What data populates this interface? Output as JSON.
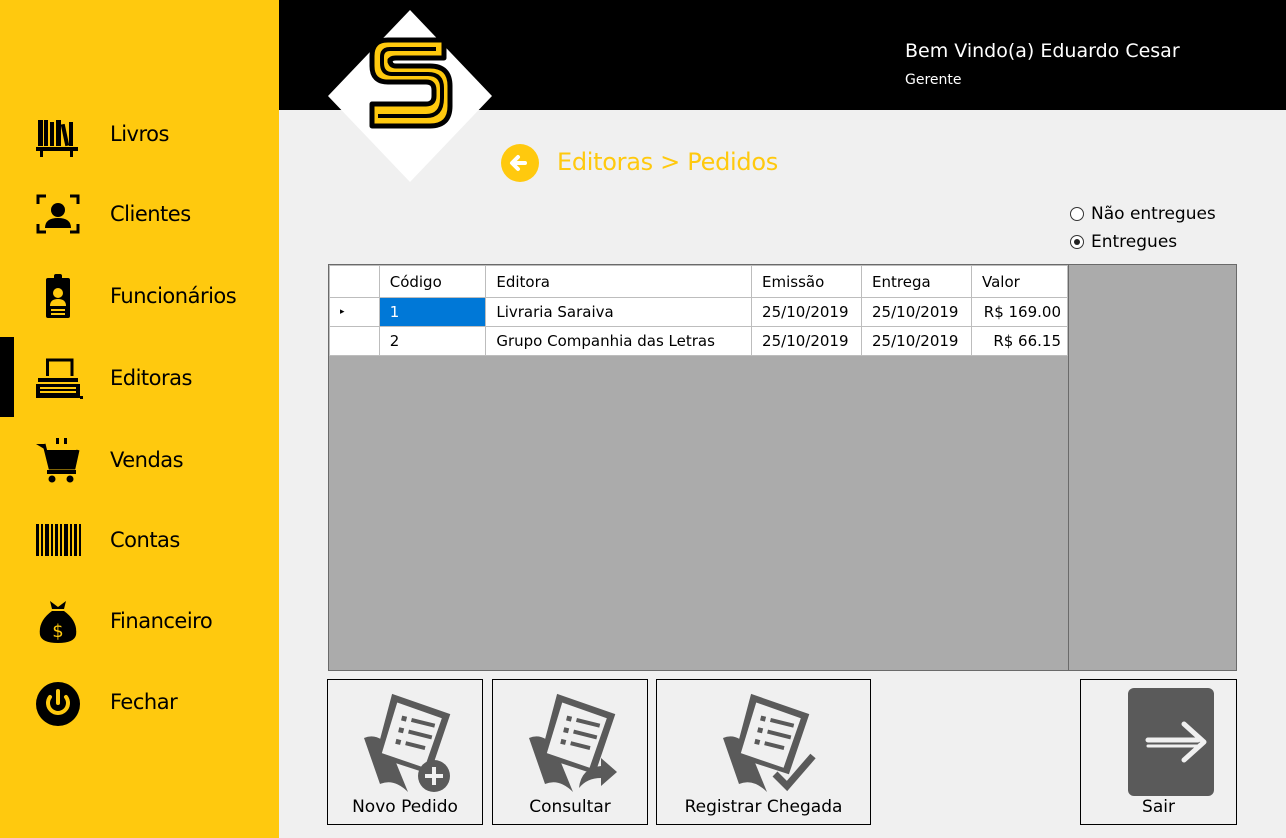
{
  "sidebar": {
    "items": [
      {
        "label": "Livros",
        "icon": "books-icon"
      },
      {
        "label": "Clientes",
        "icon": "person-scan-icon"
      },
      {
        "label": "Funcionários",
        "icon": "employee-badge-icon"
      },
      {
        "label": "Editoras",
        "icon": "typewriter-icon"
      },
      {
        "label": "Vendas",
        "icon": "shopping-cart-icon"
      },
      {
        "label": "Contas",
        "icon": "barcode-icon"
      },
      {
        "label": "Financeiro",
        "icon": "money-bag-icon"
      },
      {
        "label": "Fechar",
        "icon": "power-icon"
      }
    ],
    "active": "Editoras"
  },
  "header": {
    "welcome": "Bem Vindo(a) Eduardo Cesar",
    "role": "Gerente"
  },
  "breadcrumb": "Editoras > Pedidos",
  "filters": {
    "options": [
      {
        "label": "Não entregues",
        "checked": false
      },
      {
        "label": "Entregues",
        "checked": true
      }
    ]
  },
  "table": {
    "columns": [
      "Código",
      "Editora",
      "Emissão",
      "Entrega",
      "Valor"
    ],
    "rows": [
      {
        "codigo": "1",
        "editora": "Livraria Saraiva",
        "emissao": "25/10/2019",
        "entrega": "25/10/2019",
        "valor": "R$ 169.00"
      },
      {
        "codigo": "2",
        "editora": "Grupo Companhia das Letras",
        "emissao": "25/10/2019",
        "entrega": "25/10/2019",
        "valor": "R$ 66.15"
      }
    ],
    "current_row_marker": "▸"
  },
  "actions": {
    "novo_pedido": "Novo Pedido",
    "consultar": "Consultar",
    "registrar": "Registrar Chegada",
    "sair": "Sair"
  },
  "colors": {
    "accent": "#ffc90e",
    "header": "#000000",
    "grid_bg": "#ababab",
    "icon_gray": "#5a5a5a",
    "selection": "#0078d7"
  }
}
